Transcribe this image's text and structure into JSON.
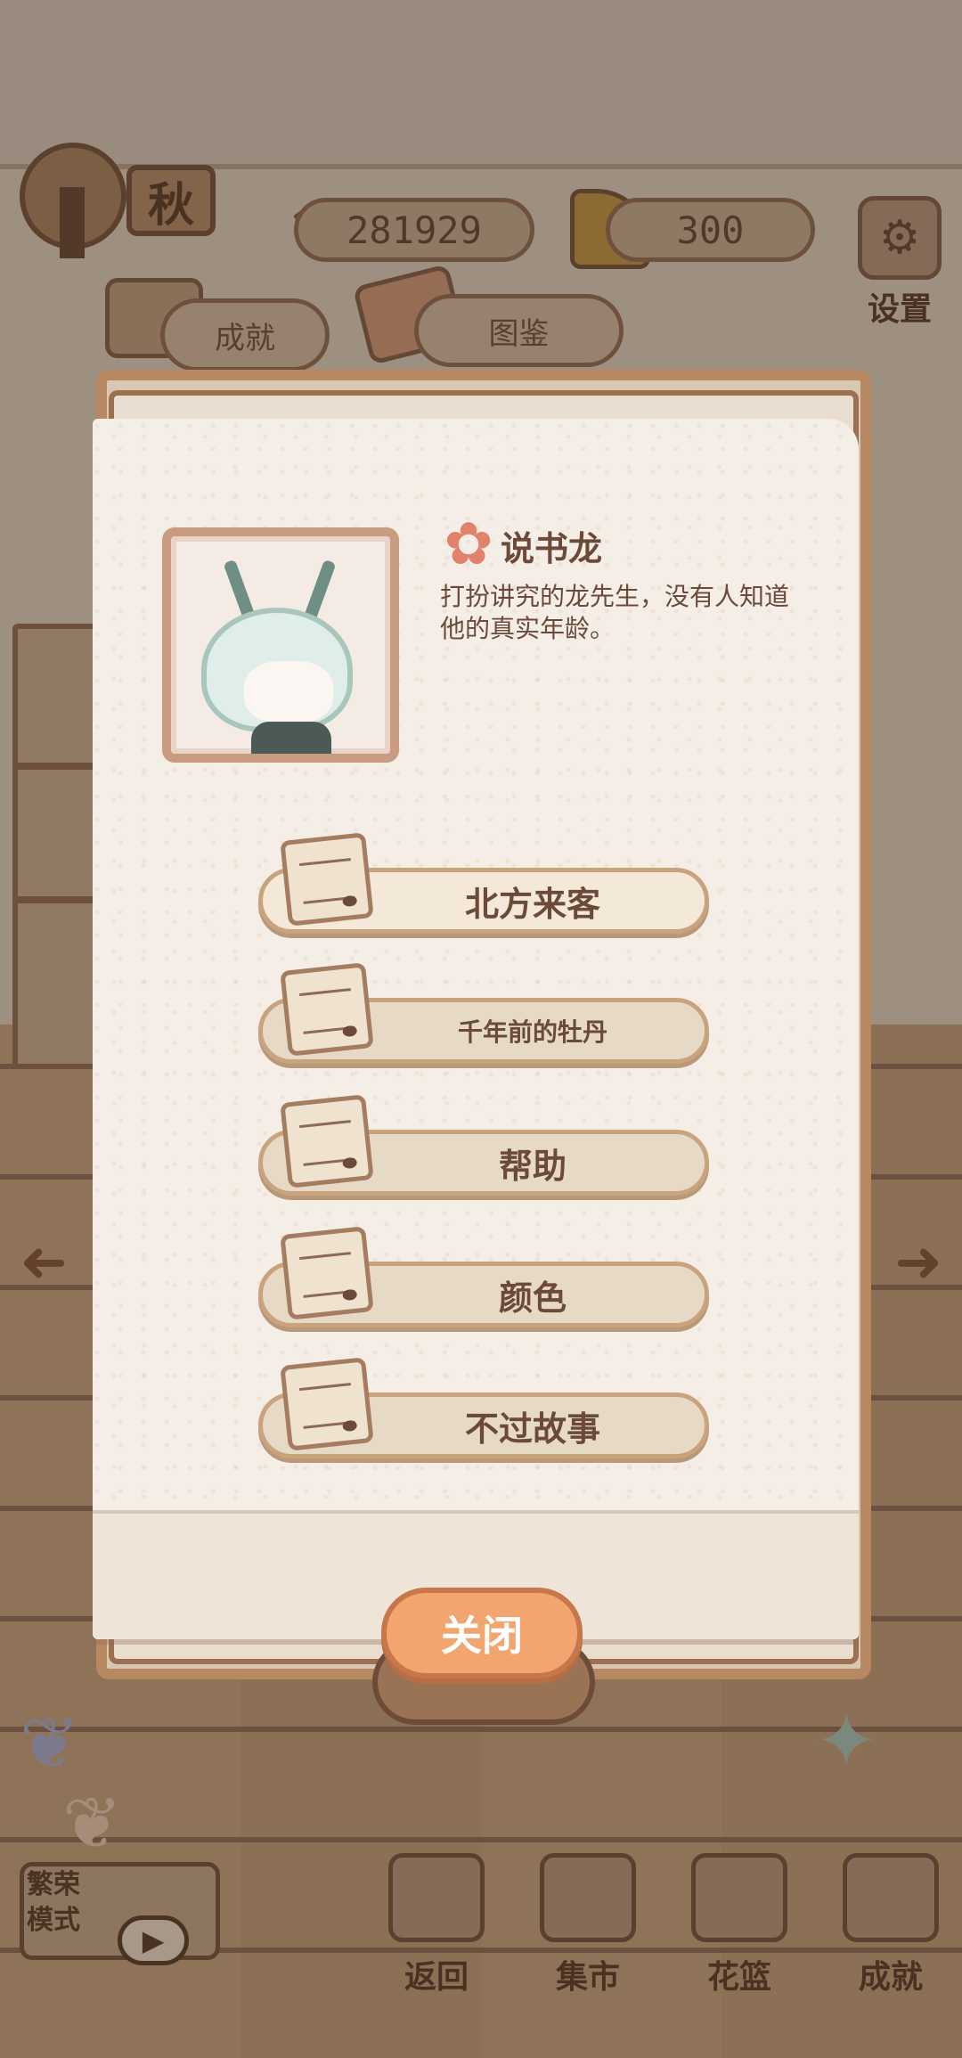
{
  "hud": {
    "season": "秋",
    "fish_count": "281929",
    "cheese_count": "300",
    "settings_label": "设置"
  },
  "tabs": [
    {
      "label": "成就"
    },
    {
      "label": "图鉴"
    }
  ],
  "character": {
    "name": "说书龙",
    "description": "打扮讲究的龙先生，没有人知道他的真实年龄。"
  },
  "stories": [
    {
      "label": "北方来客"
    },
    {
      "label": "千年前的牡丹"
    },
    {
      "label": "帮助"
    },
    {
      "label": "颜色"
    },
    {
      "label": "不过故事"
    }
  ],
  "modal": {
    "close_label": "关闭"
  },
  "bottom": {
    "mode_label": "繁荣模式",
    "items": [
      {
        "label": "返回"
      },
      {
        "label": "集市"
      },
      {
        "label": "花篮"
      },
      {
        "label": "成就"
      }
    ]
  },
  "icons": {
    "flower": "✿",
    "arrow_left": "➜",
    "arrow_right": "➜",
    "gear": "⚙",
    "fish": "♒",
    "play": "▶",
    "butterfly": "❦"
  }
}
